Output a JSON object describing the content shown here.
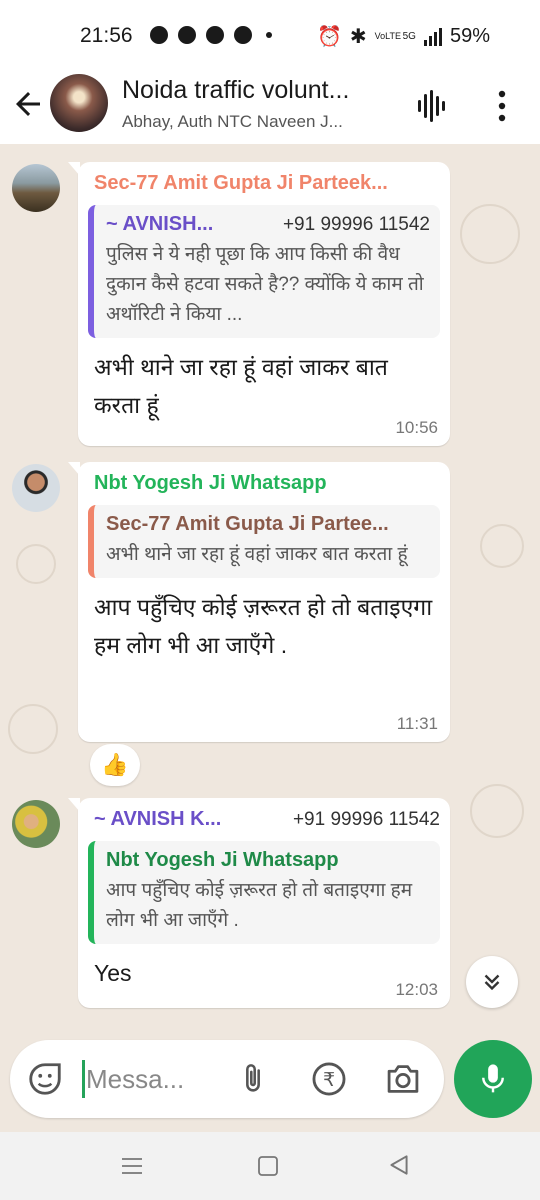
{
  "status_bar": {
    "time": "21:56",
    "battery": "59%",
    "network": "5G",
    "volte": "VoLTE"
  },
  "header": {
    "title": "Noida traffic volunt...",
    "subtitle": "Abhay, Auth NTC Naveen J..."
  },
  "messages": [
    {
      "sender": "Sec-77 Amit Gupta Ji Parteek...",
      "sender_color": "#f0846a",
      "quote": {
        "sender": "~ AVNISH...",
        "phone": "+91 99996 11542",
        "text": "पुलिस ने ये नही पूछा कि आप किसी की  वैध दुकान कैसे हटवा सकते है?? क्योंकि ये काम तो अथॉरिटी ने किया ...",
        "color": "#6a4fc8"
      },
      "text": "अभी थाने जा रहा हूं वहां जाकर बात करता हूं",
      "time": "10:56"
    },
    {
      "sender": "Nbt Yogesh Ji Whatsapp",
      "sender_color": "#23b45a",
      "quote": {
        "sender": "Sec-77 Amit Gupta Ji Partee...",
        "text": "अभी थाने जा रहा हूं वहां जाकर बात करता हूं",
        "color": "#8a5a4a",
        "bar_color": "#f0846a"
      },
      "text": "आप पहुँचिए कोई ज़रूरत हो तो बताइएगा हम लोग भी आ जाएँगे .",
      "time": "11:31",
      "reaction": "👍"
    },
    {
      "sender": "~ AVNISH K...",
      "phone": "+91 99996 11542",
      "sender_color": "#6a4fc8",
      "quote": {
        "sender": "Nbt Yogesh Ji Whatsapp",
        "text": "आप पहुँचिए कोई ज़रूरत हो तो बताइएगा हम लोग भी आ जाएँगे .",
        "color": "#1f8a48",
        "bar_color": "#23b45a"
      },
      "text": "Yes",
      "time": "12:03"
    }
  ],
  "composer": {
    "placeholder": "Messa..."
  },
  "colors": {
    "accent": "#21a559",
    "chat_background": "#efe7de"
  }
}
